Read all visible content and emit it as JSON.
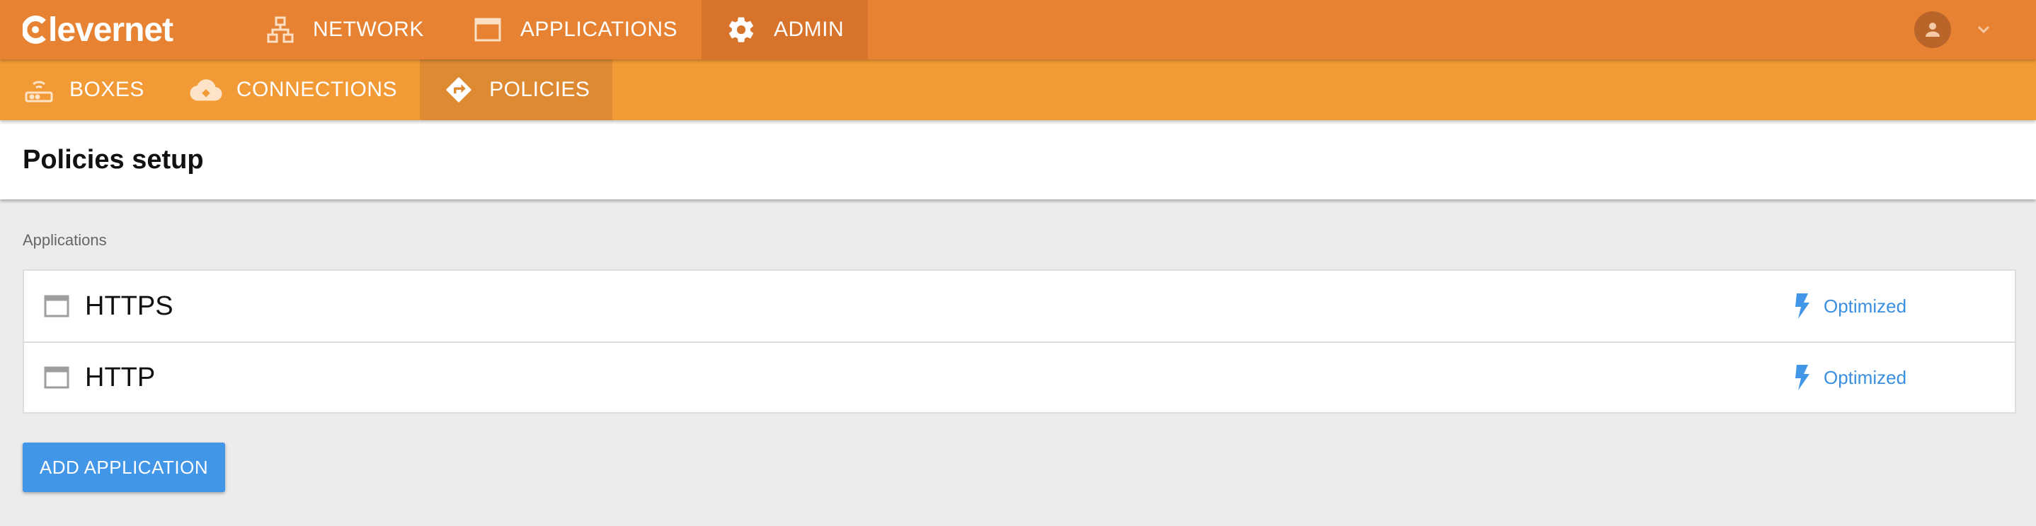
{
  "brand": {
    "name": "levernet",
    "accent": "#e78232"
  },
  "topnav": {
    "items": [
      {
        "label": "NETWORK",
        "icon": "network-icon"
      },
      {
        "label": "APPLICATIONS",
        "icon": "window-icon"
      },
      {
        "label": "ADMIN",
        "icon": "gear-icon",
        "active": true
      }
    ]
  },
  "user": {
    "icon": "account-icon",
    "menu_icon": "chevron-down-icon"
  },
  "subnav": {
    "color": "#f29a35",
    "items": [
      {
        "label": "BOXES",
        "icon": "router-icon"
      },
      {
        "label": "CONNECTIONS",
        "icon": "cloud-sync-icon"
      },
      {
        "label": "POLICIES",
        "icon": "directions-icon",
        "active": true
      }
    ]
  },
  "page": {
    "title": "Policies setup"
  },
  "applications": {
    "section_label": "Applications",
    "rows": [
      {
        "name": "HTTPS",
        "policy": "Optimized",
        "policy_icon": "bolt-icon"
      },
      {
        "name": "HTTP",
        "policy": "Optimized",
        "policy_icon": "bolt-icon"
      }
    ],
    "policy_color": "#3b8fe0"
  },
  "actions": {
    "add_application_label": "ADD APPLICATION"
  }
}
